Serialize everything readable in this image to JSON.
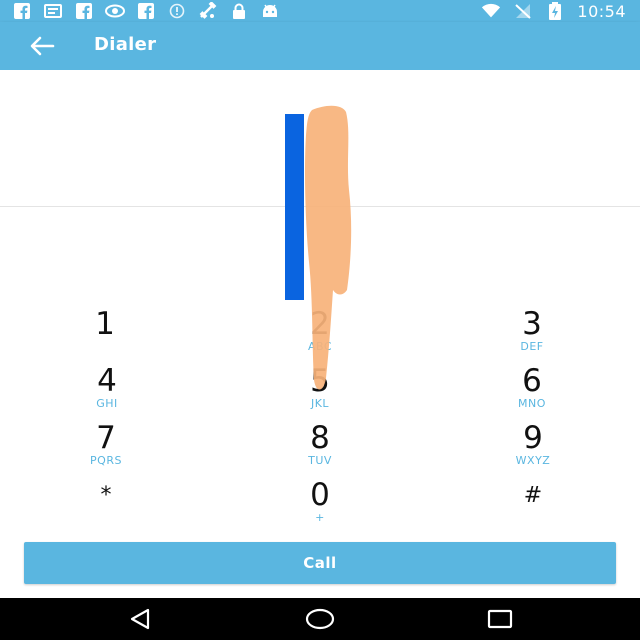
{
  "status_bar": {
    "time": "10:54",
    "left_icons": [
      "facebook-icon",
      "message-icon",
      "facebook-icon",
      "eye-icon",
      "facebook-icon",
      "info-icon",
      "satellite-icon",
      "lock-icon",
      "android-icon"
    ],
    "right_icons": [
      "wifi-icon",
      "no-signal-icon",
      "battery-charging-icon"
    ]
  },
  "toolbar": {
    "title": "Dialer",
    "back_icon": "arrow-back-icon"
  },
  "dialpad": {
    "keys": [
      {
        "digit": "1",
        "letters": ""
      },
      {
        "digit": "2",
        "letters": "ABC"
      },
      {
        "digit": "3",
        "letters": "DEF"
      },
      {
        "digit": "4",
        "letters": "GHI"
      },
      {
        "digit": "5",
        "letters": "JKL"
      },
      {
        "digit": "6",
        "letters": "MNO"
      },
      {
        "digit": "7",
        "letters": "PQRS"
      },
      {
        "digit": "8",
        "letters": "TUV"
      },
      {
        "digit": "9",
        "letters": "WXYZ"
      },
      {
        "digit": "*",
        "letters": ""
      },
      {
        "digit": "0",
        "letters": "+"
      },
      {
        "digit": "#",
        "letters": ""
      }
    ]
  },
  "call_button": {
    "label": "Call"
  },
  "nav_bar": {
    "icons": [
      "back-triangle-icon",
      "home-circle-icon",
      "recents-square-icon"
    ]
  },
  "colors": {
    "accent": "#5ab6e0",
    "overlay_bar": "#0a64e0",
    "overlay_hand": "#f7b27a"
  }
}
